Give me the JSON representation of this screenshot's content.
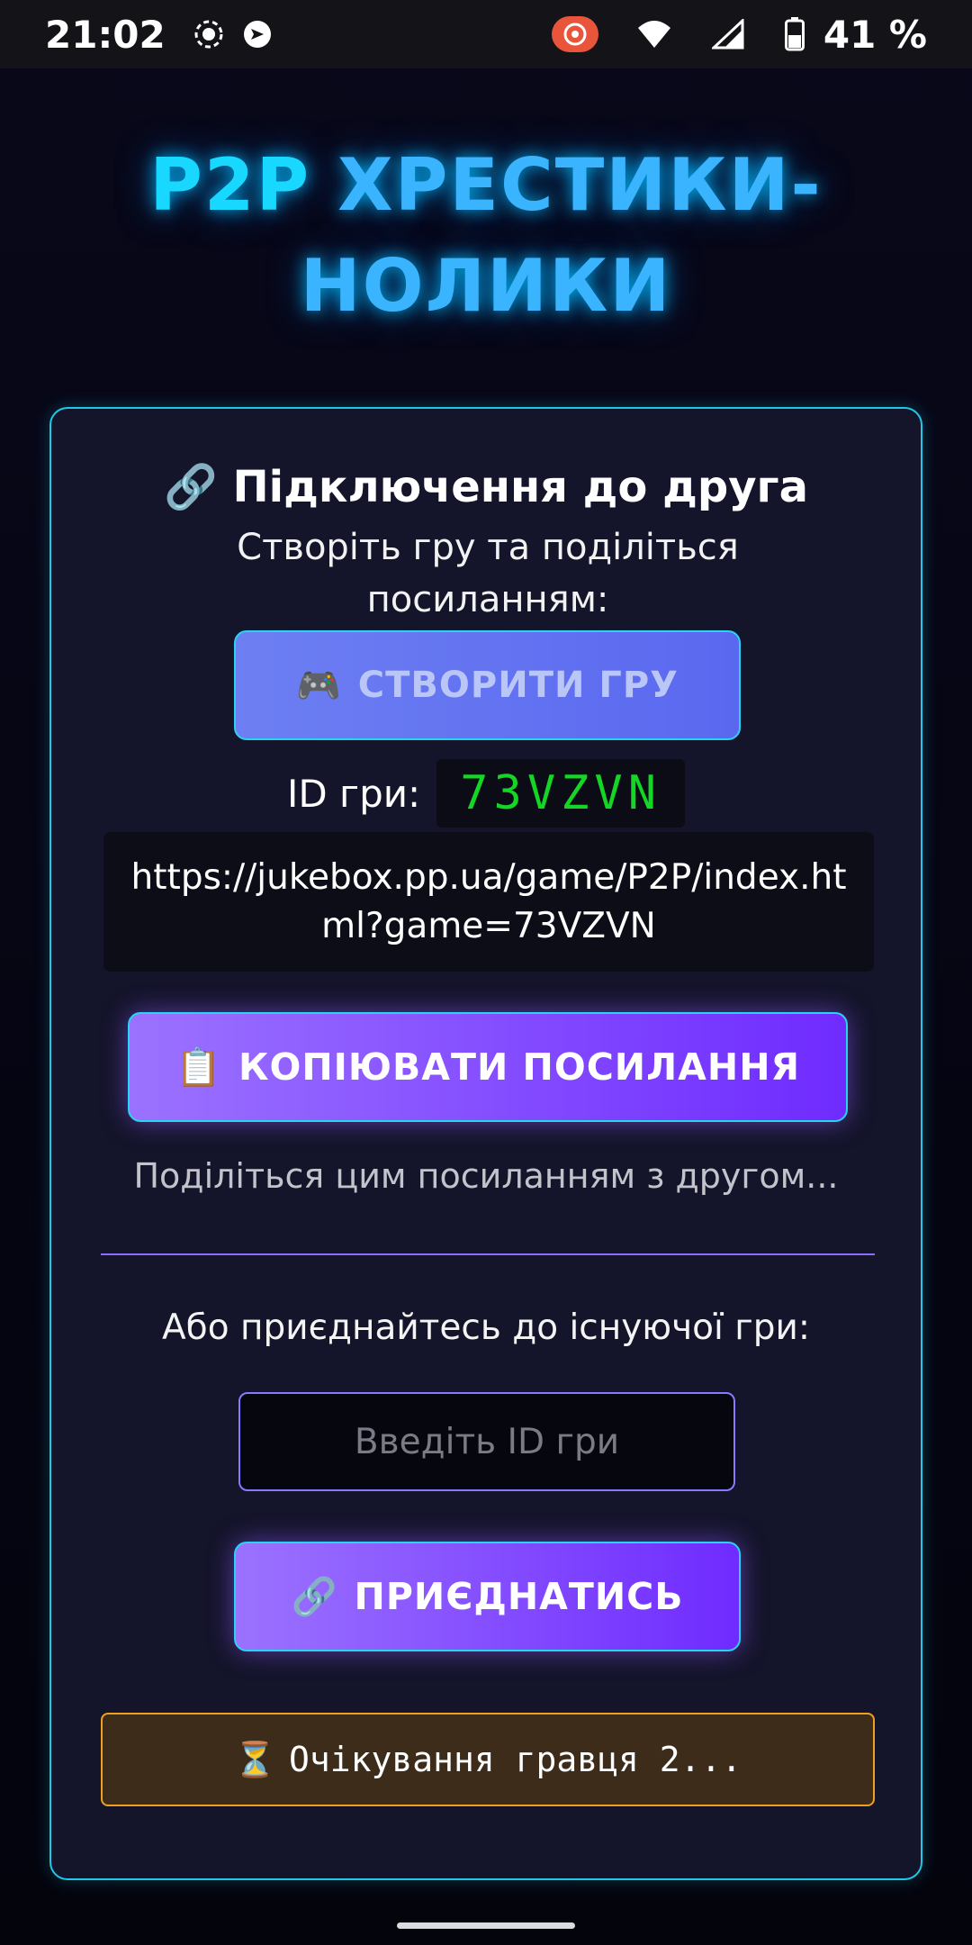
{
  "status_bar": {
    "time": "21:02",
    "battery_percent": "41 %",
    "icons": [
      "record-icon",
      "cast-icon",
      "vpn-badge-icon",
      "wifi-icon",
      "signal-icon",
      "battery-icon"
    ]
  },
  "header": {
    "title_part1": "P2P",
    "title_part2": "ХРЕСТИКИ-",
    "title_line2": "НОЛИКИ"
  },
  "connect_card": {
    "heading_icon": "🔗",
    "heading": "Підключення до друга",
    "subtitle": "Створіть гру та поділіться посиланням:",
    "create_button": {
      "icon": "🎮",
      "label": "СТВОРИТИ ГРУ"
    },
    "game_id_label": "ID гри:",
    "game_id_value": "73VZVN",
    "share_link": "https://jukebox.pp.ua/game/P2P/index.html?game=73VZVN",
    "copy_button": {
      "icon": "📋",
      "label": "КОПІЮВАТИ ПОСИЛАННЯ"
    },
    "share_hint": "Поділіться цим посиланням з другом...",
    "join_label": "Або приєднайтесь до існуючої гри:",
    "game_id_input": {
      "placeholder": "Введіть ID гри",
      "value": ""
    },
    "join_button": {
      "icon": "🔗",
      "label": "ПРИЄДНАТИСЬ"
    },
    "status": {
      "icon": "⏳",
      "text": "Очікування гравця 2..."
    }
  },
  "colors": {
    "accent_cyan": "#1ec8e6",
    "accent_purple": "#7a3cff",
    "game_id_green": "#14d624",
    "status_orange": "#f0a020"
  }
}
